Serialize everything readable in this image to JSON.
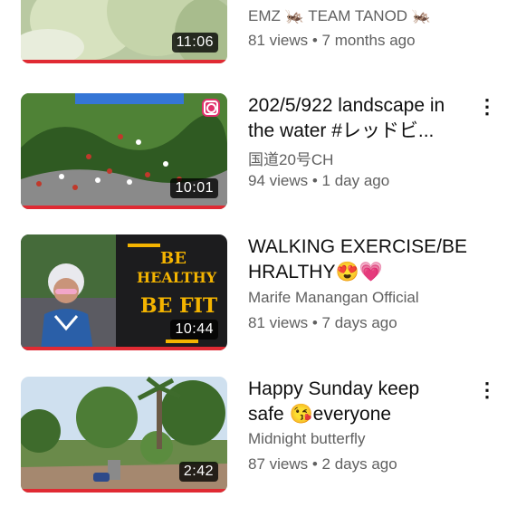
{
  "videos": [
    {
      "title": "",
      "channel": "EMZ  🦗  TEAM TANOD  🦗",
      "views": "81 views",
      "age": "7 months ago",
      "duration": "11:06"
    },
    {
      "title": "202/5/922 landscape in the water #レッドビ...",
      "channel": "国道20号CH",
      "views": "94 views",
      "age": "1 day ago",
      "duration": "10:01",
      "badge_icon": "instagram-icon"
    },
    {
      "title": "WALKING EXERCISE/BE HRALTHY😍💗",
      "channel": "Marife Manangan Official",
      "views": "81 views",
      "age": "7 days ago",
      "duration": "10:44",
      "thumb_text": [
        "BE",
        "HEALTHY",
        "BE FIT"
      ]
    },
    {
      "title": "Happy Sunday keep safe 😘everyone",
      "channel": "Midnight butterfly",
      "views": "87 views",
      "age": "2 days ago",
      "duration": "2:42"
    }
  ],
  "separator": " • ",
  "menu_label": "⋮",
  "colors": {
    "progress": "#e02a33",
    "meta_text": "#606060",
    "thumb_text": "#f4b400"
  }
}
